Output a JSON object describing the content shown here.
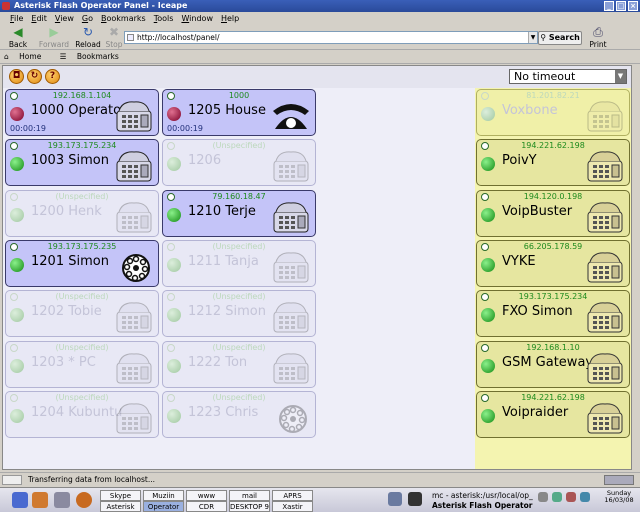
{
  "window": {
    "title": "Asterisk Flash Operator Panel - Iceape",
    "controls": [
      "_",
      "□",
      "×"
    ]
  },
  "menu": [
    "File",
    "Edit",
    "View",
    "Go",
    "Bookmarks",
    "Tools",
    "Window",
    "Help"
  ],
  "toolbar": {
    "back": "Back",
    "forward": "Forward",
    "reload": "Reload",
    "stop": "Stop",
    "search": "Search",
    "print": "Print"
  },
  "url": "http://localhost/panel/",
  "bookmarks": {
    "home": "Home",
    "bookmarks": "Bookmarks"
  },
  "panel": {
    "timeout": "No timeout",
    "buttons": [
      "lock-icon",
      "refresh-icon",
      "help-icon"
    ]
  },
  "extensions": [
    {
      "ip": "192.168.1.104",
      "name": "1000 Operator",
      "active": true,
      "dot": "red",
      "timer": "00:00:19",
      "phone": "desk"
    },
    {
      "ip": "1000",
      "name": "1205 House",
      "active": true,
      "dot": "red",
      "timer": "00:00:19",
      "phone": "rotary"
    },
    {
      "ip": "193.173.175.234",
      "name": "1003 Simon",
      "active": true,
      "dot": "green",
      "timer": "",
      "phone": "desk"
    },
    {
      "ip": "(Unspecified)",
      "name": "1206",
      "active": false,
      "dot": "",
      "timer": "",
      "phone": "desk"
    },
    {
      "ip": "(Unspecified)",
      "name": "1200 Henk",
      "active": false,
      "dot": "",
      "timer": "",
      "phone": "desk"
    },
    {
      "ip": "79.160.18.47",
      "name": "1210 Terje",
      "active": true,
      "dot": "green",
      "timer": "",
      "phone": "desk"
    },
    {
      "ip": "193.173.175.235",
      "name": "1201 Simon",
      "active": true,
      "dot": "green",
      "timer": "",
      "phone": "dial"
    },
    {
      "ip": "(Unspecified)",
      "name": "1211 Tanja",
      "active": false,
      "dot": "",
      "timer": "",
      "phone": "desk"
    },
    {
      "ip": "(Unspecified)",
      "name": "1202 Tobie",
      "active": false,
      "dot": "",
      "timer": "",
      "phone": "desk"
    },
    {
      "ip": "(Unspecified)",
      "name": "1212 Simon",
      "active": false,
      "dot": "",
      "timer": "",
      "phone": "desk"
    },
    {
      "ip": "(Unspecified)",
      "name": "1203 * PC",
      "active": false,
      "dot": "",
      "timer": "",
      "phone": "desk"
    },
    {
      "ip": "(Unspecified)",
      "name": "1222 Ton",
      "active": false,
      "dot": "",
      "timer": "",
      "phone": "desk"
    },
    {
      "ip": "(Unspecified)",
      "name": "1204 Kubuntu",
      "active": false,
      "dot": "",
      "timer": "",
      "phone": "desk"
    },
    {
      "ip": "(Unspecified)",
      "name": "1223 Chris",
      "active": false,
      "dot": "",
      "timer": "",
      "phone": "dial"
    }
  ],
  "trunks": [
    {
      "ip": "81.201.82.21",
      "name": "Voxbone",
      "active": false
    },
    {
      "ip": "194.221.62.198",
      "name": "PoivY",
      "active": true
    },
    {
      "ip": "194.120.0.198",
      "name": "VoipBuster",
      "active": true
    },
    {
      "ip": "66.205.178.59",
      "name": "VYKE",
      "active": true
    },
    {
      "ip": "193.173.175.234",
      "name": "FXO Simon",
      "active": true
    },
    {
      "ip": "192.168.1.10",
      "name": "GSM Gateway",
      "active": true
    },
    {
      "ip": "194.221.62.198",
      "name": "Voipraider",
      "active": true
    }
  ],
  "status": "Transferring data from localhost...",
  "taskbar": {
    "pager_top": [
      "Skype",
      "Muziin",
      "www",
      "mail",
      "APRS"
    ],
    "pager_bottom": [
      "Asterisk",
      "Operator",
      "CDR MYSQL",
      "DESKTOP 9",
      "Xastir"
    ],
    "windows": [
      "mc - asterisk:/usr/local/op_",
      "Asterisk Flash Operator"
    ],
    "clock": [
      "Sunday",
      "16/03/08"
    ]
  }
}
